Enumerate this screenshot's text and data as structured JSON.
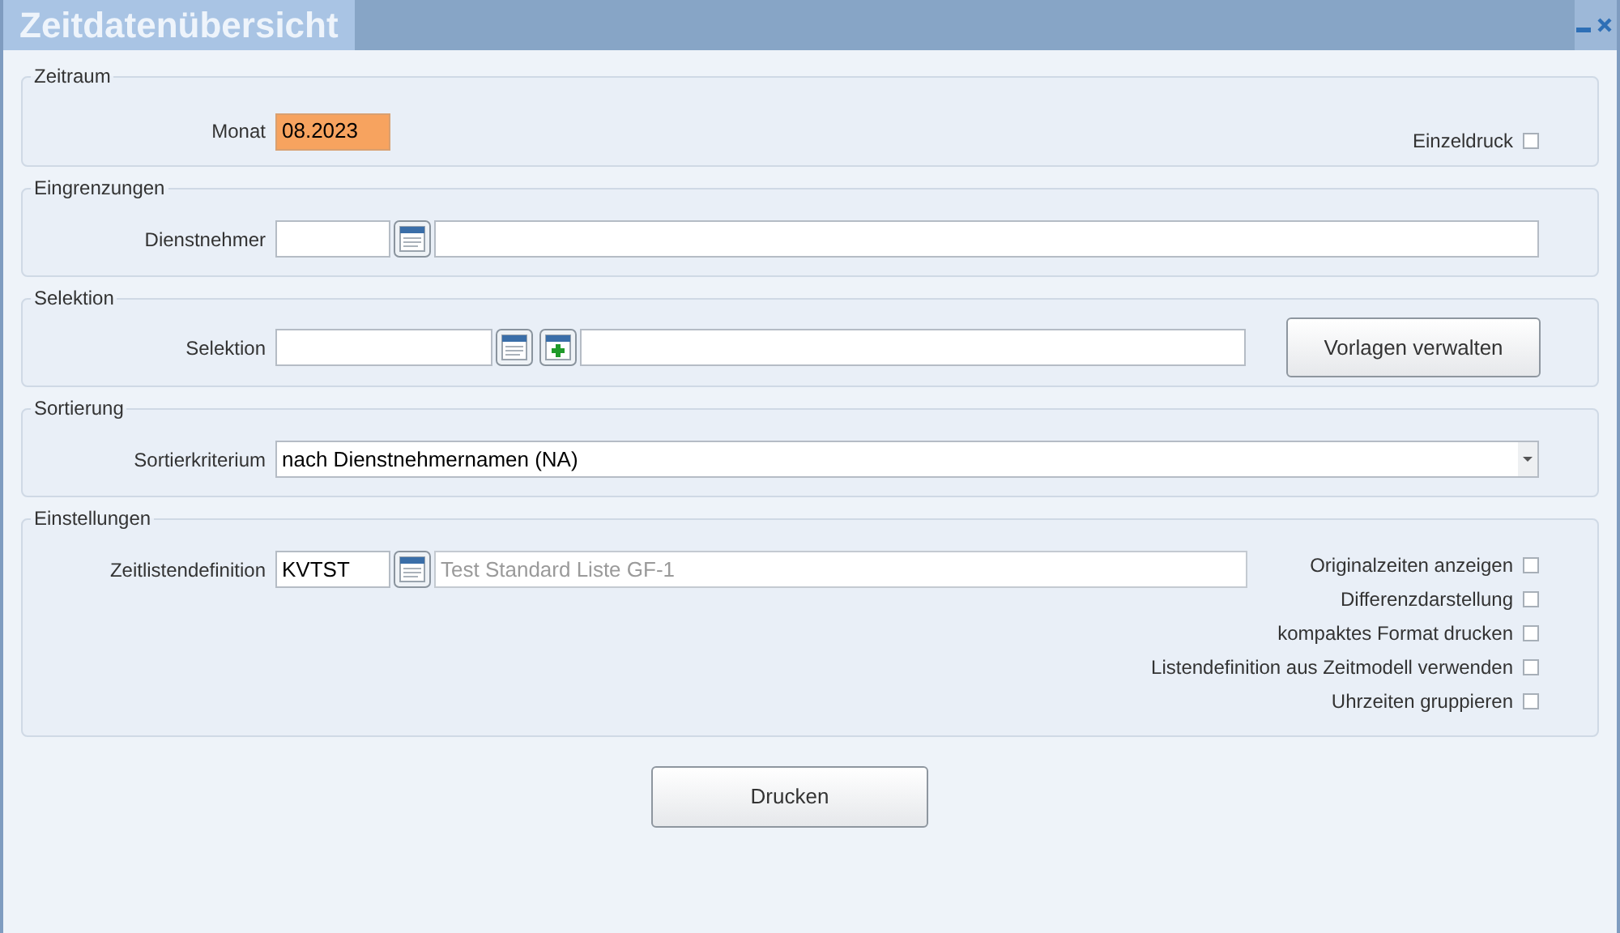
{
  "window": {
    "title": "Zeitdatenübersicht"
  },
  "zeitraum": {
    "legend": "Zeitraum",
    "month": {
      "label": "Monat",
      "value": "08.2023",
      "highlighted": true
    },
    "single_print": {
      "label": "Einzeldruck",
      "checked": false
    }
  },
  "eingrenzungen": {
    "legend": "Eingrenzungen",
    "employee": {
      "label": "Dienstnehmer"
    }
  },
  "selektion": {
    "legend": "Selektion",
    "selection": {
      "label": "Selektion"
    },
    "manage_button": "Vorlagen verwalten"
  },
  "sortierung": {
    "legend": "Sortierung",
    "criterion": {
      "label": "Sortierkriterium",
      "value": "nach Dienstnehmernamen (NA)"
    }
  },
  "einstellungen": {
    "legend": "Einstellungen",
    "definition": {
      "label": "Zeitlistendefinition",
      "code": "KVTST",
      "description": "Test Standard Liste GF-1",
      "description_disabled": true
    },
    "options": [
      {
        "label": "Originalzeiten anzeigen",
        "checked": false
      },
      {
        "label": "Differenzdarstellung",
        "checked": false
      },
      {
        "label": "kompaktes Format drucken",
        "checked": false
      },
      {
        "label": "Listendefinition aus Zeitmodell verwenden",
        "checked": false
      },
      {
        "label": "Uhrzeiten gruppieren",
        "checked": false
      }
    ]
  },
  "print_button": "Drucken"
}
